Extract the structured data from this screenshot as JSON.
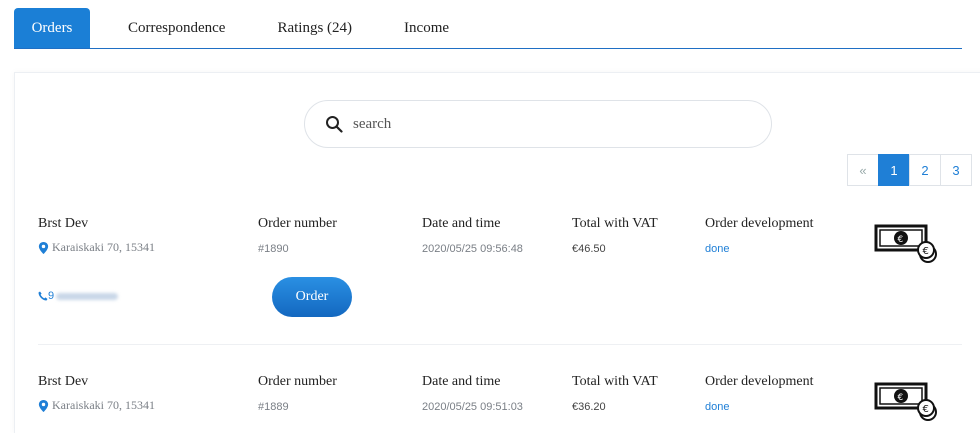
{
  "tabs": [
    {
      "label": "Orders"
    },
    {
      "label": "Correspondence"
    },
    {
      "label": "Ratings (24)"
    },
    {
      "label": "Income"
    }
  ],
  "search": {
    "placeholder": "search"
  },
  "pagination": {
    "prev": "«",
    "pages": [
      "1",
      "2",
      "3"
    ],
    "current": "1"
  },
  "columns": {
    "order_number": "Order number",
    "date_time": "Date and time",
    "total": "Total with VAT",
    "development": "Order development"
  },
  "orders": [
    {
      "name": "Brst Dev",
      "address": "Karaiskaki 70, 15341",
      "phone_prefix": "9",
      "number": "#1890",
      "datetime": "2020/05/25 09:56:48",
      "total": "€46.50",
      "status": "done",
      "button": "Order"
    },
    {
      "name": "Brst Dev",
      "address": "Karaiskaki 70, 15341",
      "number": "#1889",
      "datetime": "2020/05/25 09:51:03",
      "total": "€36.20",
      "status": "done"
    }
  ],
  "colors": {
    "accent": "#1b7fd6",
    "link": "#1f7fd6"
  }
}
